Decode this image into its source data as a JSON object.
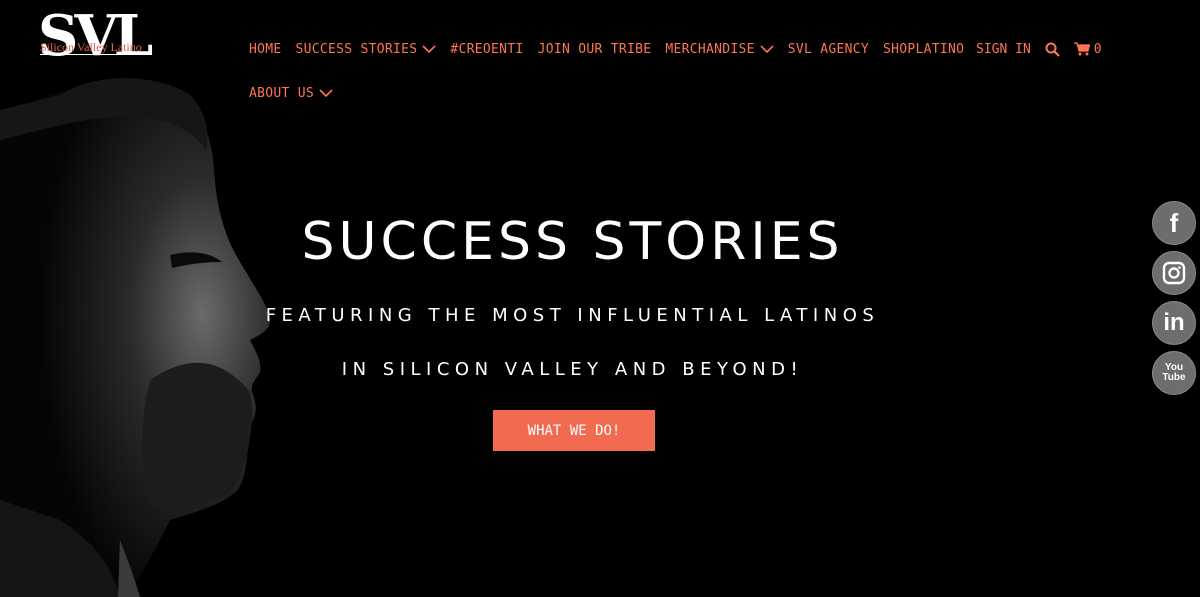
{
  "logo": {
    "monogram": "SVL",
    "wordmark": "Silicon Valley Latino"
  },
  "nav": {
    "items": [
      {
        "label": "HOME",
        "dropdown": false
      },
      {
        "label": "SUCCESS STORIES",
        "dropdown": true
      },
      {
        "label": "#CREOENTI",
        "dropdown": false
      },
      {
        "label": "JOIN OUR TRIBE",
        "dropdown": false
      },
      {
        "label": "MERCHANDISE",
        "dropdown": true
      },
      {
        "label": "SVL AGENCY",
        "dropdown": false
      },
      {
        "label": "SHOPLATINO",
        "dropdown": false
      }
    ],
    "second_row": {
      "label": "ABOUT US",
      "dropdown": true
    }
  },
  "utility": {
    "sign_in": "SIGN IN",
    "search_icon": "search-icon",
    "cart_icon": "cart-icon",
    "cart_count": "0"
  },
  "hero": {
    "title": "SUCCESS STORIES",
    "subtitle_line1": "FEATURING THE MOST INFLUENTIAL LATINOS",
    "subtitle_line2": "IN SILICON VALLEY AND BEYOND!",
    "cta": "WHAT WE DO!"
  },
  "social": [
    {
      "name": "facebook",
      "glyph": "f"
    },
    {
      "name": "instagram",
      "glyph": ""
    },
    {
      "name": "linkedin",
      "glyph": "in"
    },
    {
      "name": "youtube",
      "glyph": "You Tube"
    }
  ],
  "colors": {
    "accent": "#ff7453",
    "cta_bg": "#f26b50",
    "background": "#000000",
    "social_bg": "#6d6d6d"
  }
}
